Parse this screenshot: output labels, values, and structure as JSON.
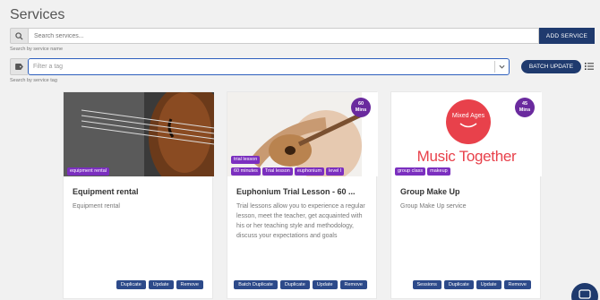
{
  "page": {
    "title": "Services"
  },
  "search": {
    "placeholder": "Search services...",
    "hint": "Search by service name",
    "add_label": "ADD SERVICE"
  },
  "tag_filter": {
    "placeholder": "Filter a tag",
    "hint": "Search by service tag",
    "batch_label": "BATCH UPDATE"
  },
  "cards": [
    {
      "title": "Equipment rental",
      "description": "Equipment rental",
      "tags": [
        "equipment rental"
      ],
      "actions": [
        "Duplicate",
        "Update",
        "Remove"
      ]
    },
    {
      "title": "Euphonium Trial Lesson - 60 ...",
      "description": "Trial lessons allow you to experience a regular lesson, meet the teacher, get acquainted with his or her teaching style and methodology, discuss your expectations and goals",
      "badge": [
        "60",
        "Mins"
      ],
      "tags": [
        "trial lesson",
        "60 minutes",
        "Trial lesson",
        "euphonium",
        "level I"
      ],
      "actions": [
        "Batch Duplicate",
        "Duplicate",
        "Update",
        "Remove"
      ]
    },
    {
      "title": "Group Make Up",
      "description": "Group Make Up service",
      "badge": [
        "45",
        "Mins"
      ],
      "logo": {
        "circle_text": "Mixed Ages",
        "wordmark": "Music Together"
      },
      "tags": [
        "group class",
        "makeup"
      ],
      "actions": [
        "Sessions",
        "Duplicate",
        "Update",
        "Remove"
      ]
    }
  ],
  "colors": {
    "primary": "#1f3a6e",
    "tag": "#7b2fbf",
    "badge": "#6a2a9e",
    "logo_red": "#e8414b"
  }
}
